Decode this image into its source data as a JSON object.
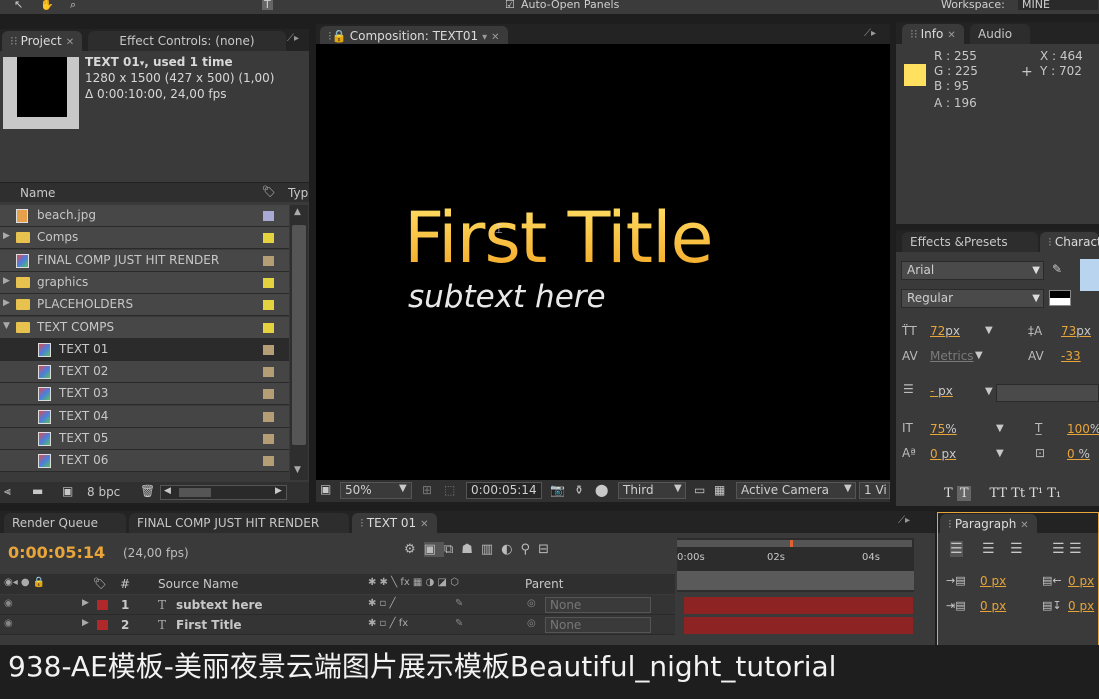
{
  "toolbar": {
    "auto_open_label": "Auto-Open Panels",
    "workspace_label": "Workspace:",
    "workspace_value": "MINE"
  },
  "project": {
    "tabs": [
      {
        "label": "Project"
      },
      {
        "label": "Effect Controls: (none)"
      }
    ],
    "selected": {
      "name": "TEXT 01",
      "used": ", used 1 time",
      "size": "1280 x 1500  (427 x 500) (1,00)",
      "duration": "Δ 0:00:10:00, 24,00 fps"
    },
    "columns": {
      "name": "Name",
      "type": "Typ"
    },
    "items": [
      {
        "label": "beach.jpg",
        "kind": "image",
        "indent": 0,
        "color": "#a9a9d6"
      },
      {
        "label": "Comps",
        "kind": "folder",
        "indent": 0,
        "color": "#e4d23e"
      },
      {
        "label": "FINAL COMP JUST HIT RENDER",
        "kind": "comp",
        "indent": 0,
        "color": "#b59e76"
      },
      {
        "label": "graphics",
        "kind": "folder",
        "indent": 0,
        "color": "#e4d23e"
      },
      {
        "label": "PLACEHOLDERS",
        "kind": "folder",
        "indent": 0,
        "color": "#e4d23e"
      },
      {
        "label": "TEXT COMPS",
        "kind": "folder",
        "indent": 0,
        "color": "#e4d23e",
        "open": true
      },
      {
        "label": "TEXT 01",
        "kind": "comp",
        "indent": 1,
        "color": "#b59e76",
        "selected": true
      },
      {
        "label": "TEXT 02",
        "kind": "comp",
        "indent": 1,
        "color": "#b59e76"
      },
      {
        "label": "TEXT 03",
        "kind": "comp",
        "indent": 1,
        "color": "#b59e76"
      },
      {
        "label": "TEXT 04",
        "kind": "comp",
        "indent": 1,
        "color": "#b59e76"
      },
      {
        "label": "TEXT 05",
        "kind": "comp",
        "indent": 1,
        "color": "#b59e76"
      },
      {
        "label": "TEXT 06",
        "kind": "comp",
        "indent": 1,
        "color": "#b59e76"
      }
    ],
    "bpc": "8 bpc"
  },
  "composition": {
    "tab_label": "Composition: TEXT01",
    "title_text": "First Title",
    "subtext": "subtext here",
    "zoom": "50%",
    "timecode": "0:00:05:14",
    "resolution": "Third",
    "camera": "Active Camera",
    "views": "1 Vi"
  },
  "info": {
    "tabs": [
      {
        "label": "Info"
      },
      {
        "label": "Audio"
      }
    ],
    "swatch_color": "#ffe15f",
    "r": "R : 255",
    "g": "G : 225",
    "b": "B : 95",
    "a": "A :  196",
    "x": "X : 464",
    "y": "Y : 702"
  },
  "character": {
    "tabs": [
      {
        "label": "Effects &Presets"
      },
      {
        "label": "Characte"
      }
    ],
    "font": "Arial",
    "style": "Regular",
    "size": "72",
    "leading": "73",
    "kerning": "Metrics",
    "tracking": "-33",
    "stroke": "-",
    "vscale": "75",
    "hscale": "100",
    "baseline": "0",
    "tsume": "0",
    "px": "px",
    "pct": "%"
  },
  "timeline": {
    "tabs": [
      {
        "label": "Render Queue"
      },
      {
        "label": "FINAL COMP JUST HIT RENDER"
      },
      {
        "label": "TEXT 01"
      }
    ],
    "time": "0:00:05:14",
    "fps": "(24,00 fps)",
    "columns": {
      "num": "#",
      "source": "Source Name",
      "parent": "Parent"
    },
    "ruler": [
      "0:00s",
      "02s",
      "04s"
    ],
    "layers": [
      {
        "num": "1",
        "name": "subtext here",
        "parent": "None"
      },
      {
        "num": "2",
        "name": "First Title",
        "parent": "None"
      }
    ]
  },
  "paragraph": {
    "tab_label": "Paragraph",
    "v1": "0 px",
    "v2": "0 px",
    "v3": "0 px",
    "v4": "0 px"
  },
  "caption": "938-AE模板-美丽夜景云端图片展示模板Beautiful_night_tutorial"
}
